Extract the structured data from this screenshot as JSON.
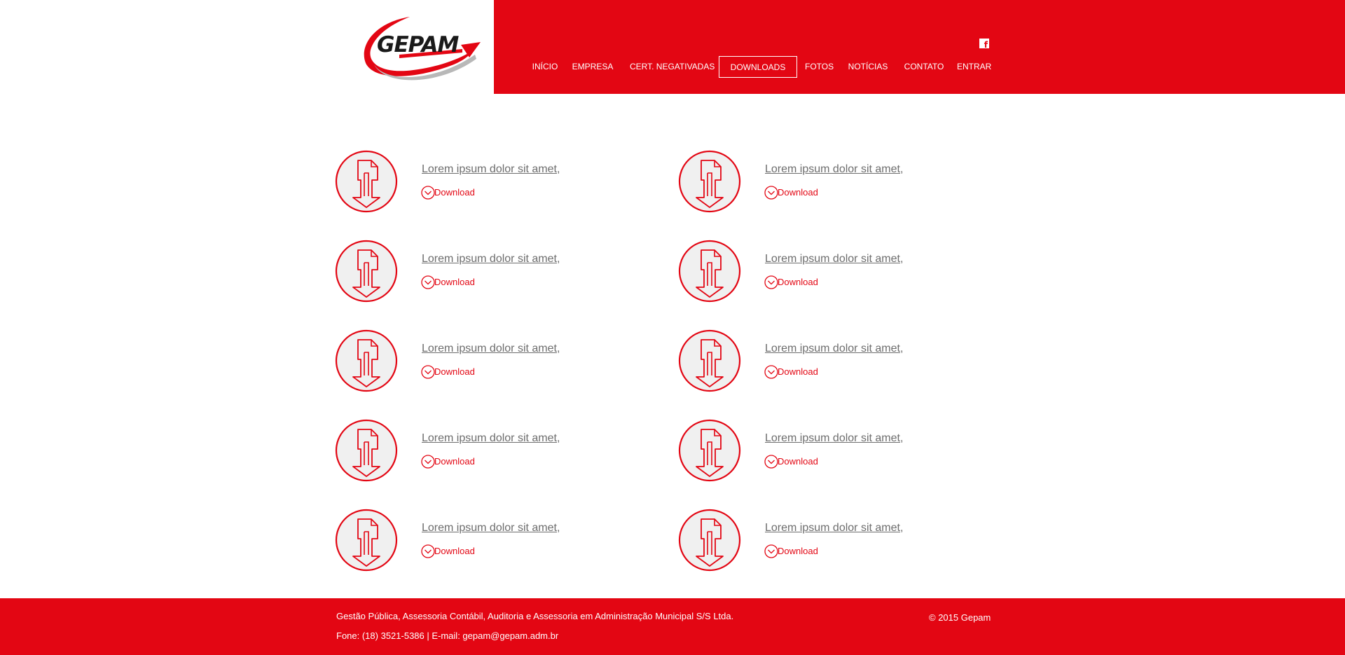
{
  "brand": {
    "logo_text": "GEPAM",
    "primary_color": "#e30613"
  },
  "header": {
    "social_icon": "facebook-icon",
    "nav": [
      {
        "label": "INÍCIO",
        "active": false
      },
      {
        "label": "EMPRESA",
        "active": false
      },
      {
        "label": "CERT. NEGATIVADAS",
        "active": false
      },
      {
        "label": "DOWNLOADS",
        "active": true
      },
      {
        "label": "FOTOS",
        "active": false
      },
      {
        "label": "NOTÍCIAS",
        "active": false
      },
      {
        "label": "CONTATO",
        "active": false
      },
      {
        "label": "ENTRAR",
        "active": false
      }
    ]
  },
  "downloads": {
    "icon": "file-download-icon",
    "items": [
      {
        "title": "Lorem ipsum dolor sit amet,",
        "link_label": "Download"
      },
      {
        "title": "Lorem ipsum dolor sit amet,",
        "link_label": "Download"
      },
      {
        "title": "Lorem ipsum dolor sit amet,",
        "link_label": "Download"
      },
      {
        "title": "Lorem ipsum dolor sit amet,",
        "link_label": "Download"
      },
      {
        "title": "Lorem ipsum dolor sit amet,",
        "link_label": "Download"
      },
      {
        "title": "Lorem ipsum dolor sit amet,",
        "link_label": "Download"
      },
      {
        "title": "Lorem ipsum dolor sit amet,",
        "link_label": "Download"
      },
      {
        "title": "Lorem ipsum dolor sit amet,",
        "link_label": "Download"
      },
      {
        "title": "Lorem ipsum dolor sit amet,",
        "link_label": "Download"
      },
      {
        "title": "Lorem ipsum dolor sit amet,",
        "link_label": "Download"
      }
    ]
  },
  "footer": {
    "company": "Gestão Pública, Assessoria Contábil, Auditoria e Assessoria em Administração Municipal S/S Ltda.",
    "contact": "Fone: (18) 3521-5386 | E-mail: gepam@gepam.adm.br",
    "copyright": "© 2015 Gepam"
  }
}
